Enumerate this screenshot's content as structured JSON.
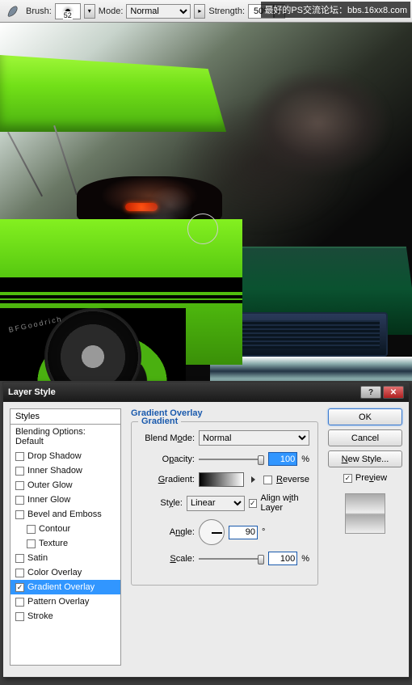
{
  "watermark": "最好的PS交流论坛：bbs.16xx8.com",
  "toolbar": {
    "brush_label": "Brush:",
    "brush_size": "52",
    "mode_label": "Mode:",
    "mode_value": "Normal",
    "strength_label": "Strength:",
    "strength_value": "50%"
  },
  "canvas": {
    "tire_text": "BFGoodrich"
  },
  "dialog": {
    "title": "Layer Style",
    "styles_header": "Styles",
    "blending_options": "Blending Options: Default",
    "items": {
      "drop_shadow": "Drop Shadow",
      "inner_shadow": "Inner Shadow",
      "outer_glow": "Outer Glow",
      "inner_glow": "Inner Glow",
      "bevel": "Bevel and Emboss",
      "contour": "Contour",
      "texture": "Texture",
      "satin": "Satin",
      "color_overlay": "Color Overlay",
      "gradient_overlay": "Gradient Overlay",
      "pattern_overlay": "Pattern Overlay",
      "stroke": "Stroke"
    },
    "panel": {
      "title": "Gradient Overlay",
      "legend": "Gradient",
      "blend_mode": "Blend Mode:",
      "blend_mode_v": "Normal",
      "opacity": "Opacity:",
      "opacity_v": "100",
      "pct": "%",
      "gradient": "Gradient:",
      "reverse": "Reverse",
      "style": "Style:",
      "style_v": "Linear",
      "align": "Align with Layer",
      "angle": "Angle:",
      "angle_v": "90",
      "deg": "°",
      "scale": "Scale:",
      "scale_v": "100"
    },
    "buttons": {
      "ok": "OK",
      "cancel": "Cancel",
      "new_style": "New Style...",
      "preview": "Preview"
    }
  }
}
